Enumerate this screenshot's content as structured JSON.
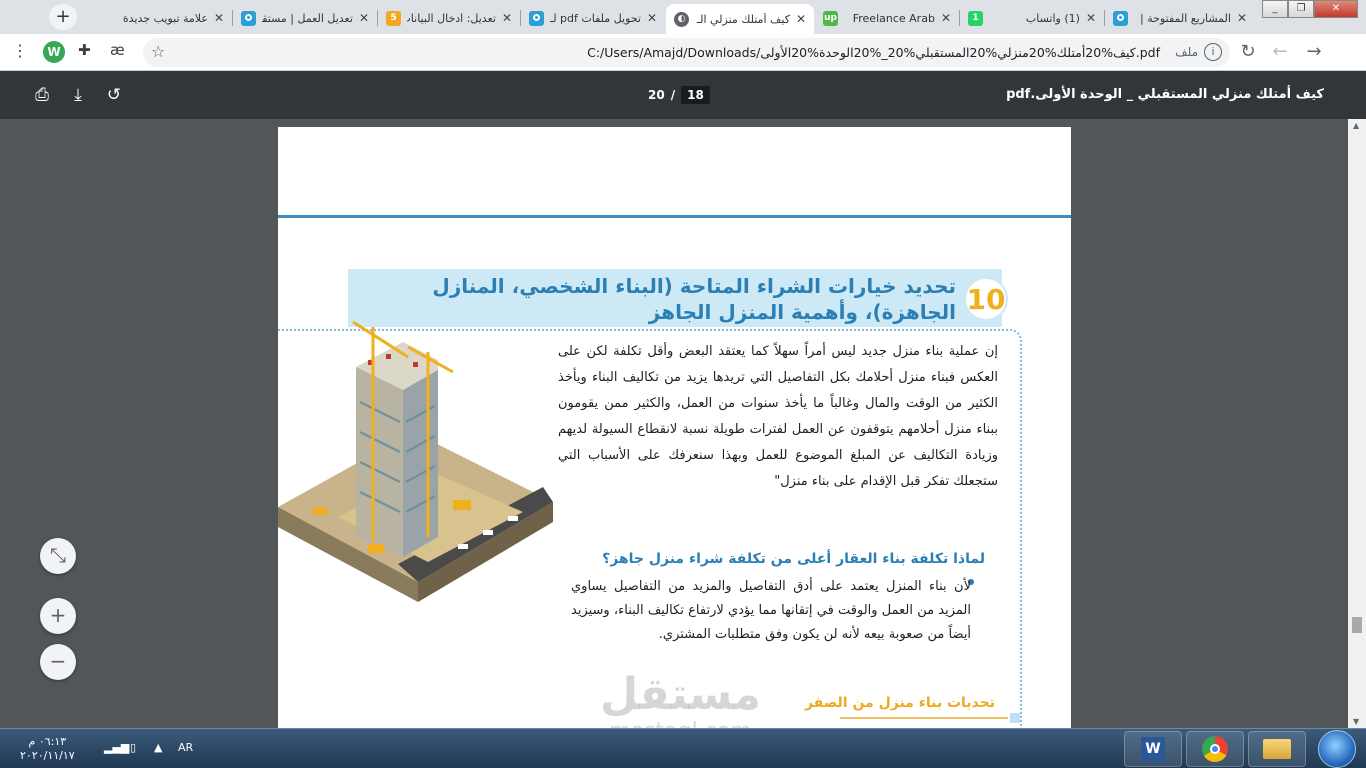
{
  "browser": {
    "tabs": [
      {
        "label": "علامة تبويب جديدة",
        "icon": "",
        "icon_color": "#dee1e6",
        "active": false
      },
      {
        "label": "تعديل العمل | مستقل",
        "icon": "mostaql-icon",
        "icon_color": "#2b9fd6",
        "active": false
      },
      {
        "label": "تعديل: ادخال البيانات",
        "icon": "5",
        "icon_color": "#f5a623",
        "active": false
      },
      {
        "label": "تحويل ملفات pdf لـ",
        "icon": "mostaql-icon",
        "icon_color": "#2b9fd6",
        "active": false
      },
      {
        "label": "كيف أمتلك منزلي الـ",
        "icon": "globe-icon",
        "icon_color": "#5f6368",
        "active": true
      },
      {
        "label": "Freelance Arab",
        "icon": "up",
        "icon_color": "#4fb848",
        "active": false
      },
      {
        "label": "(1) واتساب",
        "icon": "1",
        "icon_color": "#25d366",
        "active": false
      },
      {
        "label": "المشاريع المفتوحة |",
        "icon": "mostaql-icon",
        "icon_color": "#2b9fd6",
        "active": false
      }
    ],
    "new_tab_symbol": "+",
    "close_symbol": "✕",
    "address": {
      "file_label": "ملف",
      "url": "C:/Users/Amajd/Downloads/كيف%20أمتلك%20منزلي%20المستقبلي%20_%20الوحدة%20الأولى.pdf"
    },
    "profile_initial": "W",
    "ext_label": "æ"
  },
  "pdf_viewer": {
    "title": "كيف أمتلك منزلي المستقبلي _ الوحدة الأولى.pdf",
    "current_page": "18",
    "page_sep": "/",
    "total_pages": "20"
  },
  "document": {
    "section_number": "10",
    "heading": "تحديد خيارات الشراء المتاحة (البناء الشخصي، المنازل الجاهزة)، وأهمية المنزل الجاهز",
    "body": "إن عملية بناء منزل جديد ليس أمراً سهلاً كما يعتقد البعض وأقل تكلفة لكن على العكس فبناء منزل أحلامك بكل التفاصيل التي تريدها يزيد من تكاليف البناء ويأخذ الكثير من الوقت والمال وغالباً ما يأخذ سنوات من العمل، والكثير ممن يقومون ببناء منزل أحلامهم يتوقفون عن العمل لفترات طويلة نسبة لانقطاع السيولة لديهم وزيادة التكاليف عن المبلغ الموضوع للعمل وبهذا سنعرفك على الأسباب التي ستجعلك تفكر قبل الإقدام على بناء منزل\"",
    "subheading": "لماذا تكلفة بناء العقار أعلى من تكلفة شراء منزل جاهز؟",
    "bullet": "لأن بناء المنزل يعتمد على أدق التفاصيل والمزيد من التفاصيل يساوي المزيد من العمل والوقت في إتقانها مما يؤدي لارتفاع تكاليف البناء، وسيزيد أيضاً من صعوبة بيعه لأنه لن يكون وفق متطلبات المشتري.",
    "subheading2": "تحديات بناء منزل من الصفر"
  },
  "watermark": {
    "line1": "مستقل",
    "line2": "mostaql.com"
  },
  "zoom": {
    "fit": "⤡",
    "in": "+",
    "out": "−"
  },
  "taskbar": {
    "time": "٠٦:١٣ م",
    "date": "٢٠٢٠/١١/١٧",
    "lang": "AR"
  },
  "colors": {
    "accent_blue": "#2a7fb5",
    "accent_orange": "#f0b01e",
    "heading_band": "#cde9f6"
  }
}
